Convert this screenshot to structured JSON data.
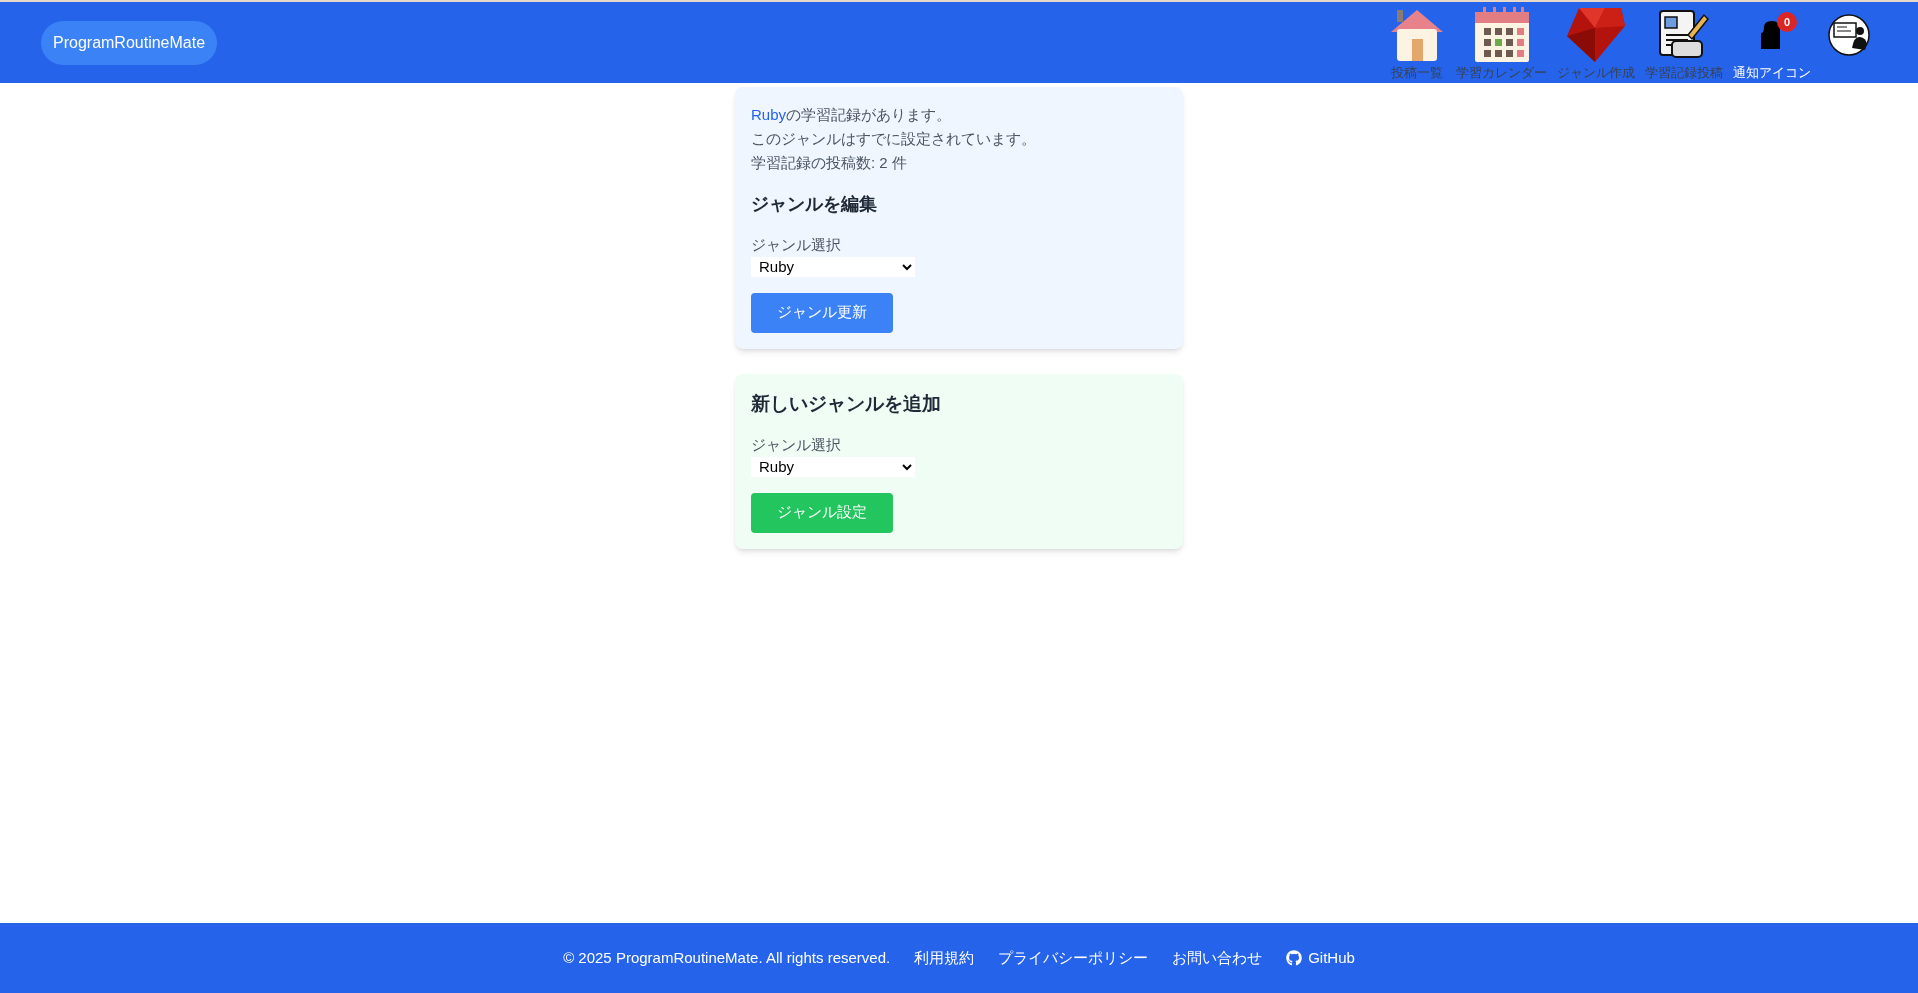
{
  "header": {
    "logo": "ProgramRoutineMate",
    "nav": [
      {
        "kind": "house",
        "label": "投稿一覧"
      },
      {
        "kind": "calendar",
        "label": "学習カレンダー"
      },
      {
        "kind": "gem",
        "label": "ジャンル作成"
      },
      {
        "kind": "document",
        "label": "学習記録投稿"
      },
      {
        "kind": "bell",
        "label": "通知アイコン",
        "badge": "0"
      },
      {
        "kind": "avatar"
      }
    ]
  },
  "edit_card": {
    "genre_link": "Ruby",
    "notice_rest": "の学習記録があります。",
    "status": "このジャンルはすでに設定されています。",
    "count": "学習記録の投稿数: 2 件",
    "title": "ジャンルを編集",
    "select_label": "ジャンル選択",
    "select_value": "Ruby",
    "button": "ジャンル更新"
  },
  "add_card": {
    "title": "新しいジャンルを追加",
    "select_label": "ジャンル選択",
    "select_value": "Ruby",
    "button": "ジャンル設定"
  },
  "footer": {
    "copyright": "© 2025 ProgramRoutineMate. All rights reserved.",
    "links": [
      {
        "label": "利用規約"
      },
      {
        "label": "プライバシーポリシー"
      },
      {
        "label": "お問い合わせ"
      },
      {
        "label": "GitHub",
        "kind": "github"
      }
    ]
  }
}
